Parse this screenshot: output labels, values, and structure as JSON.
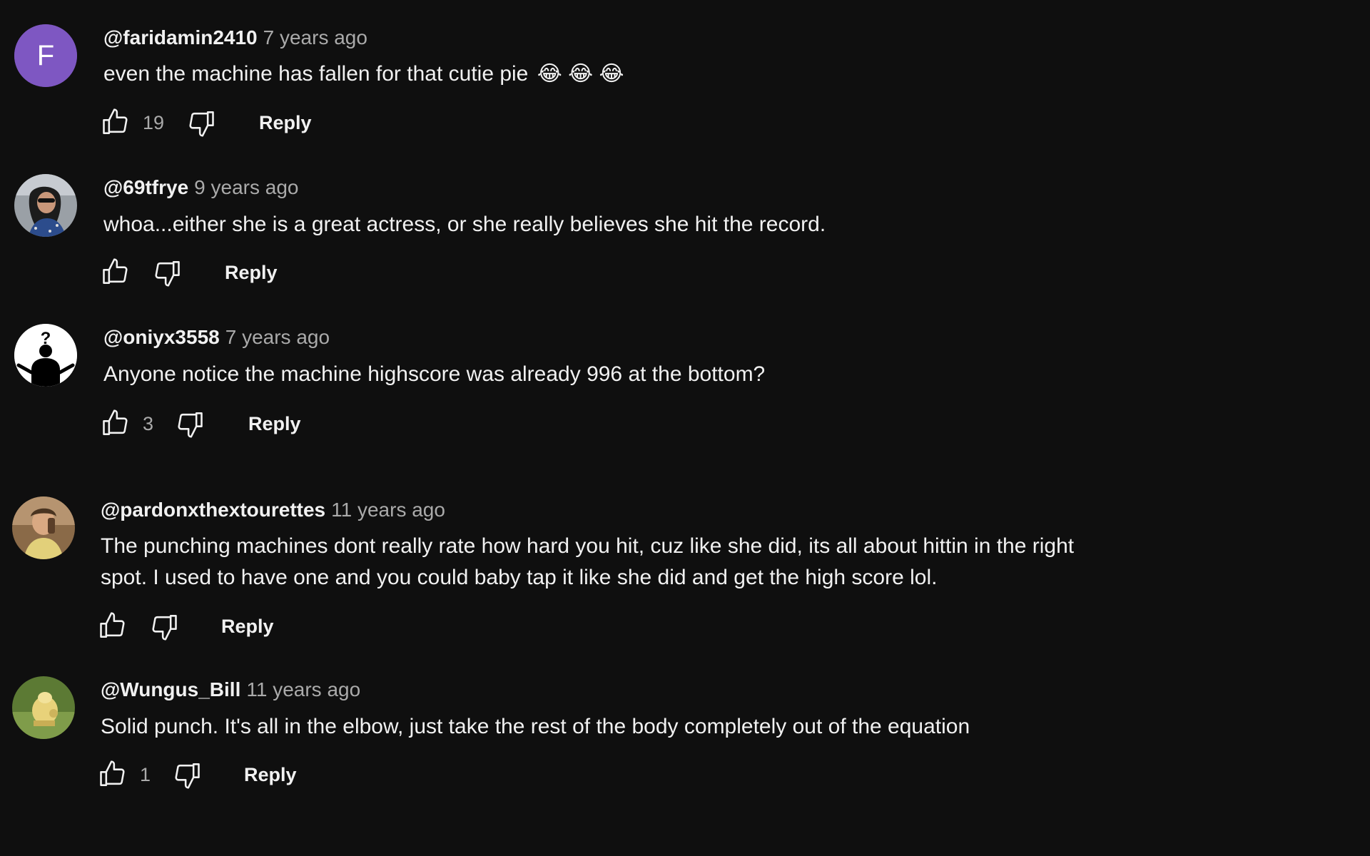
{
  "comments": [
    {
      "author": "@faridamin2410",
      "time": "7 years ago",
      "text": "even the machine has fallen for that cutie pie",
      "emoji": "😂 😂 😂",
      "likes": "19",
      "avatar_letter": "F",
      "avatar_color": "#7e57c2",
      "reply": "Reply"
    },
    {
      "author": "@69tfrye",
      "time": "9 years ago",
      "text": "whoa...either she is a great actress, or she really believes she hit the record.",
      "likes": "",
      "reply": "Reply"
    },
    {
      "author": "@oniyx3558",
      "time": "7 years ago",
      "text": "Anyone notice the machine highscore was already 996 at the bottom?",
      "likes": "3",
      "avatar_glyph": "?",
      "reply": "Reply"
    },
    {
      "author": "@pardonxthextourettes",
      "time": "11 years ago",
      "text": "The punching machines dont really rate how hard you hit, cuz like she did, its all about hittin in the right spot. I used to have one and you could baby tap it like she did and get the high score lol.",
      "likes": "",
      "reply": "Reply"
    },
    {
      "author": "@Wungus_Bill",
      "time": "11 years ago",
      "text": "Solid punch. It's all in the elbow, just take the rest of the body completely out of the equation",
      "likes": "1",
      "reply": "Reply"
    }
  ],
  "colors": {
    "background": "#0f0f0f",
    "text_primary": "#f1f1f1",
    "text_secondary": "#aaaaaa"
  }
}
